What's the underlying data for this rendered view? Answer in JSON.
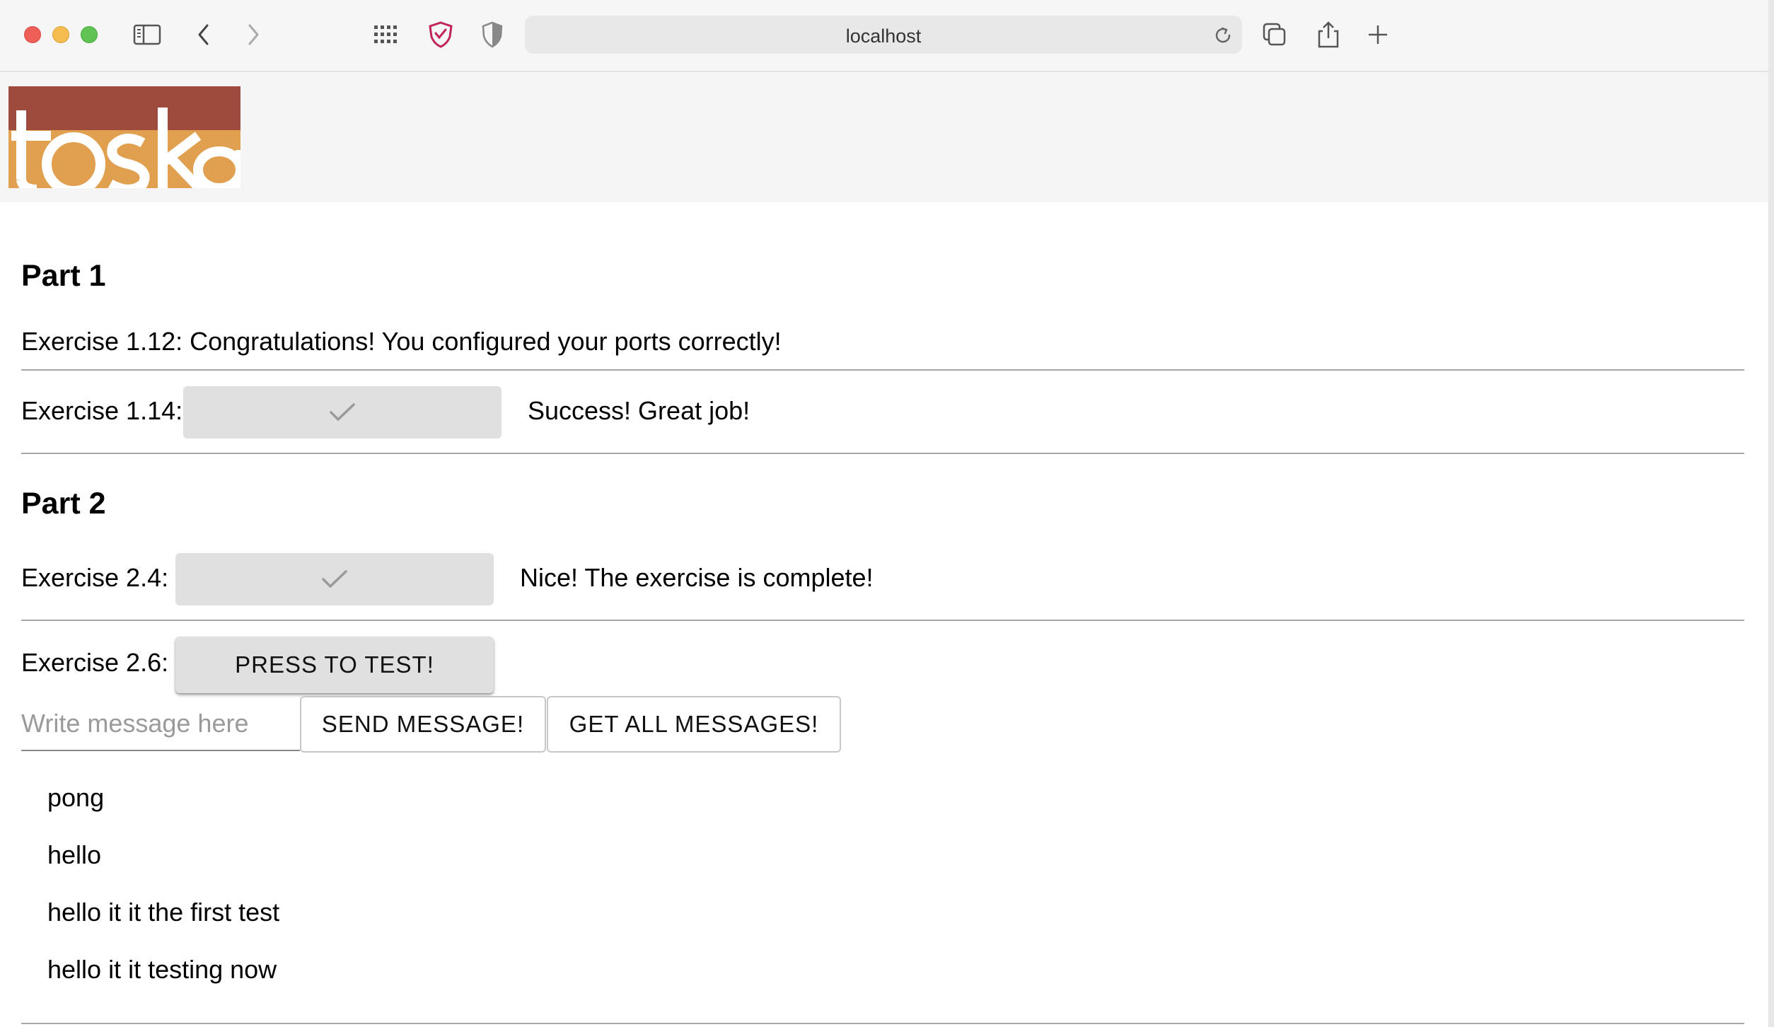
{
  "browser": {
    "url": "localhost"
  },
  "logo": {
    "text": "toska",
    "colors": {
      "top": "#9e4a3c",
      "bottom": "#e0a050",
      "letters": "#ffffff"
    }
  },
  "part1": {
    "heading": "Part 1",
    "ex112": "Exercise 1.12: Congratulations! You configured your ports correctly!",
    "ex114_label": "Exercise 1.14:",
    "ex114_status": "Success! Great job!"
  },
  "part2": {
    "heading": "Part 2",
    "ex24_label": "Exercise 2.4:",
    "ex24_status": "Nice! The exercise is complete!",
    "ex26_label": "Exercise 2.6:",
    "press_button": "PRESS TO TEST!",
    "message_placeholder": "Write message here",
    "send_button": "SEND MESSAGE!",
    "get_button": "GET ALL MESSAGES!",
    "messages": [
      "pong",
      "hello",
      "hello it it the first test",
      "hello it it testing now"
    ]
  }
}
